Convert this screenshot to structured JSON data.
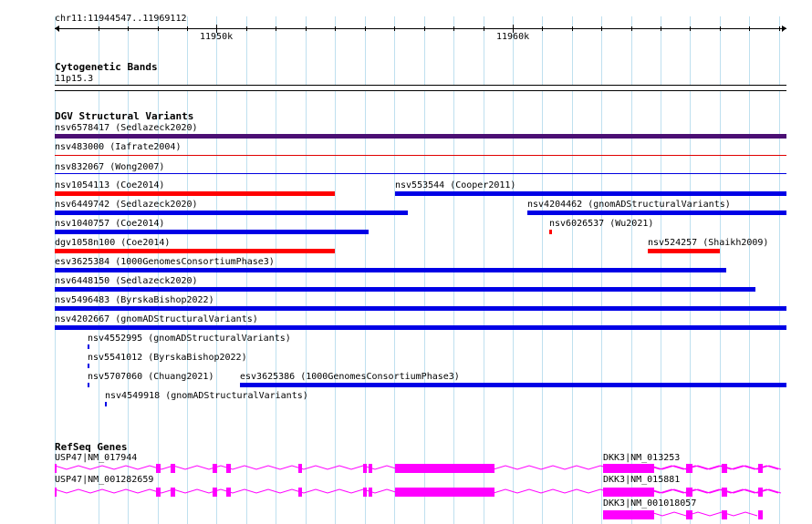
{
  "ruler": {
    "location": "chr11:11944547..11969112",
    "ticks": [
      {
        "label": "11950k"
      },
      {
        "label": "11960k"
      }
    ]
  },
  "cytoband": {
    "title": "Cytogenetic Bands",
    "band": "11p15.3"
  },
  "dgv": {
    "title": "DGV Structural Variants",
    "variants": [
      {
        "label": "nsv6578417 (Sedlazeck2020)",
        "color": "#4b0f73"
      },
      {
        "label": "nsv483000 (Iafrate2004)",
        "color": "#e00000"
      },
      {
        "label": "nsv832067 (Wong2007)",
        "color": "#0000e0"
      },
      {
        "label": "nsv1054113 (Coe2014)",
        "color": "#ff0000"
      },
      {
        "label": "nsv553544 (Cooper2011)",
        "color": "#0000e6"
      },
      {
        "label": "nsv6449742 (Sedlazeck2020)",
        "color": "#0000e6"
      },
      {
        "label": "nsv4204462 (gnomADStructuralVariants)",
        "color": "#0000e6"
      },
      {
        "label": "nsv1040757 (Coe2014)",
        "color": "#0000e6"
      },
      {
        "label": "nsv6026537 (Wu2021)",
        "color": "#ff0000"
      },
      {
        "label": "dgv1058n100 (Coe2014)",
        "color": "#ff0000"
      },
      {
        "label": "nsv524257 (Shaikh2009)",
        "color": "#ff0000"
      },
      {
        "label": "esv3625384 (1000GenomesConsortiumPhase3)",
        "color": "#0000e6"
      },
      {
        "label": "nsv6448150 (Sedlazeck2020)",
        "color": "#0000e6"
      },
      {
        "label": "nsv5496483 (ByrskaBishop2022)",
        "color": "#0000e6"
      },
      {
        "label": "nsv4202667 (gnomADStructuralVariants)",
        "color": "#0000e6"
      },
      {
        "label": "nsv4552995 (gnomADStructuralVariants)",
        "color": "#0000e6"
      },
      {
        "label": "nsv5541012 (ByrskaBishop2022)",
        "color": "#0000e6"
      },
      {
        "label": "nsv5707060 (Chuang2021)",
        "color": "#0000e6"
      },
      {
        "label": "esv3625386 (1000GenomesConsortiumPhase3)",
        "color": "#0000e6"
      },
      {
        "label": "nsv4549918 (gnomADStructuralVariants)",
        "color": "#0000e6"
      }
    ]
  },
  "refseq": {
    "title": "RefSeq Genes",
    "genes": [
      {
        "label": "USP47|NM_017944",
        "color": "#ff00ff"
      },
      {
        "label": "USP47|NM_001282659",
        "color": "#ff00ff"
      },
      {
        "label": "DKK3|NM_013253",
        "color": "#ff00ff"
      },
      {
        "label": "DKK3|NM_015881",
        "color": "#ff00ff"
      },
      {
        "label": "DKK3|NM_001018057",
        "color": "#ff00ff"
      }
    ]
  }
}
